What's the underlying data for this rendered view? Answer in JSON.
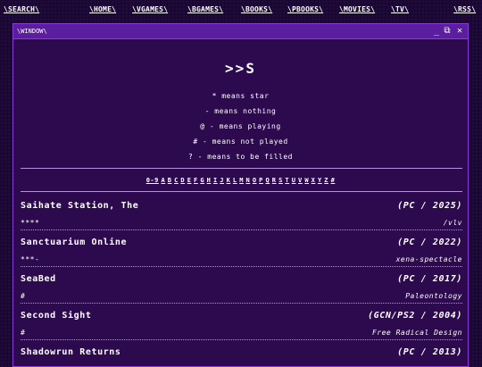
{
  "nav": {
    "search": "\\SEARCH\\",
    "home": "\\HOME\\",
    "vgames": "\\VGAMES\\",
    "bgames": "\\BGAMES\\",
    "books": "\\BOOKS\\",
    "pbooks": "\\PBOOKS\\",
    "movies": "\\MOVIES\\",
    "tv": "\\TV\\",
    "rss": "\\RSS\\"
  },
  "window": {
    "title": "\\WINDOW\\",
    "minimize_glyph": "_",
    "maximize_glyph": "⧉",
    "close_glyph": "✕"
  },
  "heading": ">>S",
  "legend": [
    "* means star",
    "- means nothing",
    "@ - means playing",
    "# - means not played",
    "? - means to be filled"
  ],
  "alphabet": [
    "0-9",
    "A",
    "B",
    "C",
    "D",
    "E",
    "F",
    "G",
    "H",
    "I",
    "J",
    "K",
    "L",
    "M",
    "N",
    "O",
    "P",
    "Q",
    "R",
    "S",
    "T",
    "U",
    "V",
    "W",
    "X",
    "Y",
    "Z",
    "#"
  ],
  "entries": [
    {
      "title": "Saihate Station, The",
      "platform": "(PC / 2025)",
      "rating": "****",
      "author": "/vlv"
    },
    {
      "title": "Sanctuarium Online",
      "platform": "(PC / 2022)",
      "rating": "***-",
      "author": "xena-spectacle"
    },
    {
      "title": "SeaBed",
      "platform": "(PC / 2017)",
      "rating": "#",
      "author": "Paleontology"
    },
    {
      "title": "Second Sight",
      "platform": "(GCN/PS2 / 2004)",
      "rating": "#",
      "author": "Free Radical Design"
    },
    {
      "title": "Shadowrun Returns",
      "platform": "(PC / 2013)",
      "rating": "",
      "author": ""
    }
  ]
}
